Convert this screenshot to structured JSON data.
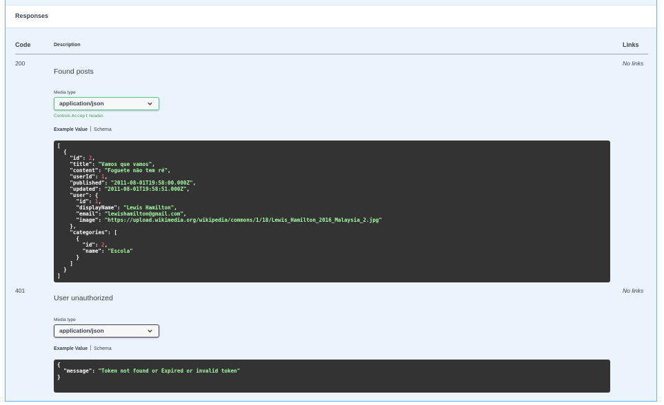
{
  "section": {
    "title": "Responses"
  },
  "table_headers": {
    "code": "Code",
    "description": "Description",
    "links": "Links"
  },
  "responses": [
    {
      "code": "200",
      "description": "Found posts",
      "links": "No links",
      "media_type_label": "Media type",
      "media_type": "application/json",
      "controls_prefix": "Controls ",
      "controls_code": "Accept",
      "controls_suffix": " header.",
      "tab_example": "Example Value",
      "tab_schema": "Schema",
      "example_lines": [
        "[",
        "  {",
        "    \"id\": 2,",
        "    \"title\": \"Vamos que vamos\",",
        "    \"content\": \"Foguete não tem ré\",",
        "    \"userId\": 1,",
        "    \"published\": \"2011-08-01T19:58:00.000Z\",",
        "    \"updated\": \"2011-08-01T19:58:51.000Z\",",
        "    \"user\": {",
        "      \"id\": 1,",
        "      \"displayName\": \"Lewis Hamilton\",",
        "      \"email\": \"lewishamilton@gmail.com\",",
        "      \"image\": \"https://upload.wikimedia.org/wikipedia/commons/1/18/Lewis_Hamilton_2016_Malaysia_2.jpg\"",
        "    },",
        "    \"categories\": [",
        "      {",
        "        \"id\": 2,",
        "        \"name\": \"Escola\"",
        "      }",
        "    ]",
        "  }",
        "]"
      ]
    },
    {
      "code": "401",
      "description": "User unauthorized",
      "links": "No links",
      "media_type_label": "Media type",
      "media_type": "application/json",
      "tab_example": "Example Value",
      "tab_schema": "Schema",
      "example_lines": [
        "{",
        "  \"message\": \"Token not found or Expired or invalid token\"",
        "}"
      ]
    }
  ],
  "colors": {
    "accent_green": "#49cc90",
    "code_bg": "#333333",
    "string_color": "#a2fca2",
    "number_color": "#d36363",
    "panel_bg": "#ebf3fb",
    "border_blue": "#61affe"
  },
  "icons": {
    "select_chevron": "chevron-down-icon"
  }
}
